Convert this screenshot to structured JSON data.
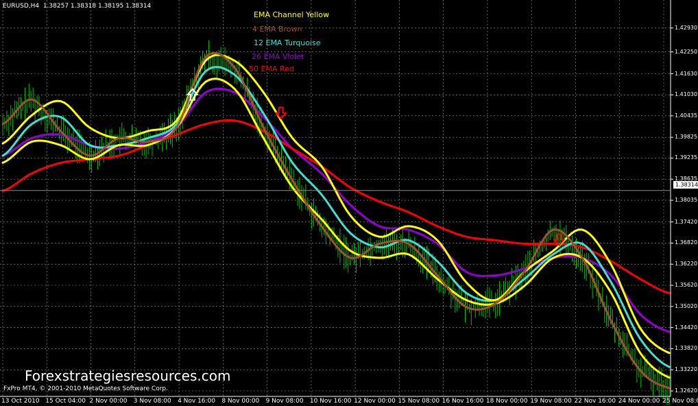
{
  "header": {
    "symbol_line": "EURUSD,H4  1.38257 1.38318 1.38195 1.38314"
  },
  "watermark": "Forexstrategiesresources.com",
  "copyright": "FxPro MT4, © 2001-2010 MetaQuotes Software Corp.",
  "current_price_label": "1.38314",
  "legend": [
    {
      "text": "EMA Channel Yellow",
      "color": "#ffff00"
    },
    {
      "text": "4 EMA Brown",
      "color": "#a0522d"
    },
    {
      "text": "12 EMA Turquoise",
      "color": "#40e0d0"
    },
    {
      "text": "26 EMA Violet",
      "color": "#9400d3"
    },
    {
      "text": "50 EMA Red",
      "color": "#ff0000"
    }
  ],
  "chart_data": {
    "type": "line",
    "ylim": [
      1.3262,
      1.4314
    ],
    "y_ticks": [
      "1.42930",
      "1.42250",
      "1.41630",
      "1.41030",
      "1.40435",
      "1.39825",
      "1.39235",
      "1.38635",
      "1.38035",
      "1.37420",
      "1.36820",
      "1.36220",
      "1.35620",
      "1.35020",
      "1.34420",
      "1.33820",
      "1.33220",
      "1.32620"
    ],
    "x_ticks": [
      "13 Oct 2010",
      "15 Oct 04:00",
      "2 Nov 00:00",
      "3 Nov 08:00",
      "4 Nov 16:00",
      "8 Nov 00:00",
      "9 Nov 08:00",
      "10 Nov 16:00",
      "12 Nov 00:00",
      "15 Nov 08:00",
      "16 Nov 16:00",
      "18 Nov 00:00",
      "19 Nov 08:00",
      "22 Nov 16:00",
      "24 Nov 00:00",
      "25 Nov 08:00"
    ],
    "grid": true,
    "current_price": 1.38314,
    "series": [
      {
        "name": "EMA Channel Yellow",
        "color": "#ffff00",
        "values": [
          1.3965,
          1.4045,
          1.4085,
          1.401,
          1.398,
          1.4,
          1.403,
          1.42,
          1.42,
          1.411,
          1.398,
          1.39,
          1.376,
          1.37,
          1.373,
          1.369,
          1.357,
          1.352,
          1.36,
          1.366,
          1.372,
          1.362,
          1.344,
          1.337
        ]
      },
      {
        "name": "EMA Channel Yellow",
        "color": "#ffff00",
        "values": [
          1.391,
          1.397,
          1.396,
          1.392,
          1.396,
          1.396,
          1.401,
          1.414,
          1.412,
          1.398,
          1.384,
          1.375,
          1.366,
          1.364,
          1.365,
          1.358,
          1.352,
          1.351,
          1.356,
          1.364,
          1.364,
          1.354,
          1.337,
          1.33
        ]
      },
      {
        "name": "4 EMA Brown",
        "color": "#a0522d",
        "values": [
          1.402,
          1.409,
          1.4,
          1.393,
          1.398,
          1.397,
          1.401,
          1.421,
          1.418,
          1.401,
          1.386,
          1.373,
          1.364,
          1.368,
          1.368,
          1.359,
          1.35,
          1.351,
          1.36,
          1.372,
          1.364,
          1.346,
          1.332,
          1.327
        ]
      },
      {
        "name": "12 EMA Turquoise",
        "color": "#40e0d0",
        "values": [
          1.393,
          1.402,
          1.404,
          1.396,
          1.396,
          1.398,
          1.402,
          1.417,
          1.416,
          1.405,
          1.391,
          1.382,
          1.371,
          1.367,
          1.369,
          1.363,
          1.354,
          1.352,
          1.358,
          1.365,
          1.368,
          1.357,
          1.341,
          1.333
        ]
      },
      {
        "name": "26 EMA Violet",
        "color": "#9400d3",
        "values": [
          1.393,
          1.398,
          1.399,
          1.396,
          1.395,
          1.397,
          1.401,
          1.411,
          1.411,
          1.404,
          1.395,
          1.388,
          1.379,
          1.373,
          1.372,
          1.368,
          1.36,
          1.359,
          1.361,
          1.364,
          1.364,
          1.359,
          1.348,
          1.343
        ]
      },
      {
        "name": "50 EMA Red",
        "color": "#ff0000",
        "values": [
          1.383,
          1.388,
          1.391,
          1.392,
          1.393,
          1.396,
          1.399,
          1.402,
          1.403,
          1.4,
          1.395,
          1.39,
          1.384,
          1.38,
          1.377,
          1.373,
          1.37,
          1.369,
          1.368,
          1.368,
          1.367,
          1.363,
          1.358,
          1.354
        ]
      }
    ]
  },
  "arrows": [
    {
      "kind": "up",
      "color": "#ffffff",
      "index": 6.55
    },
    {
      "kind": "down",
      "color": "#ff0000",
      "index": 9.6
    },
    {
      "kind": "down",
      "color": "#ff0000",
      "index": 19.2
    }
  ]
}
